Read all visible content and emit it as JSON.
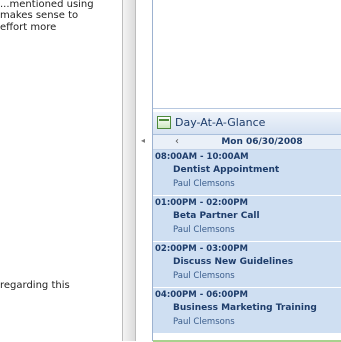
{
  "left_pane": {
    "lines": [
      "...mentioned using",
      "makes sense to",
      "effort more",
      "regarding this"
    ]
  },
  "splitter": {
    "grip": "◂"
  },
  "day_at_a_glance": {
    "title": "Day-At-A-Glance",
    "prev_arrow": "‹",
    "date": "Mon 06/30/2008",
    "appointments": [
      {
        "time": "08:00AM - 10:00AM",
        "title": "Dentist Appointment",
        "owner": "Paul Clemsons"
      },
      {
        "time": "01:00PM - 02:00PM",
        "title": "Beta Partner Call",
        "owner": "Paul Clemsons"
      },
      {
        "time": "02:00PM - 03:00PM",
        "title": "Discuss New Guidelines",
        "owner": "Paul Clemsons"
      },
      {
        "time": "04:00PM - 06:00PM",
        "title": "Business Marketing Training",
        "owner": "Paul Clemsons"
      }
    ]
  }
}
